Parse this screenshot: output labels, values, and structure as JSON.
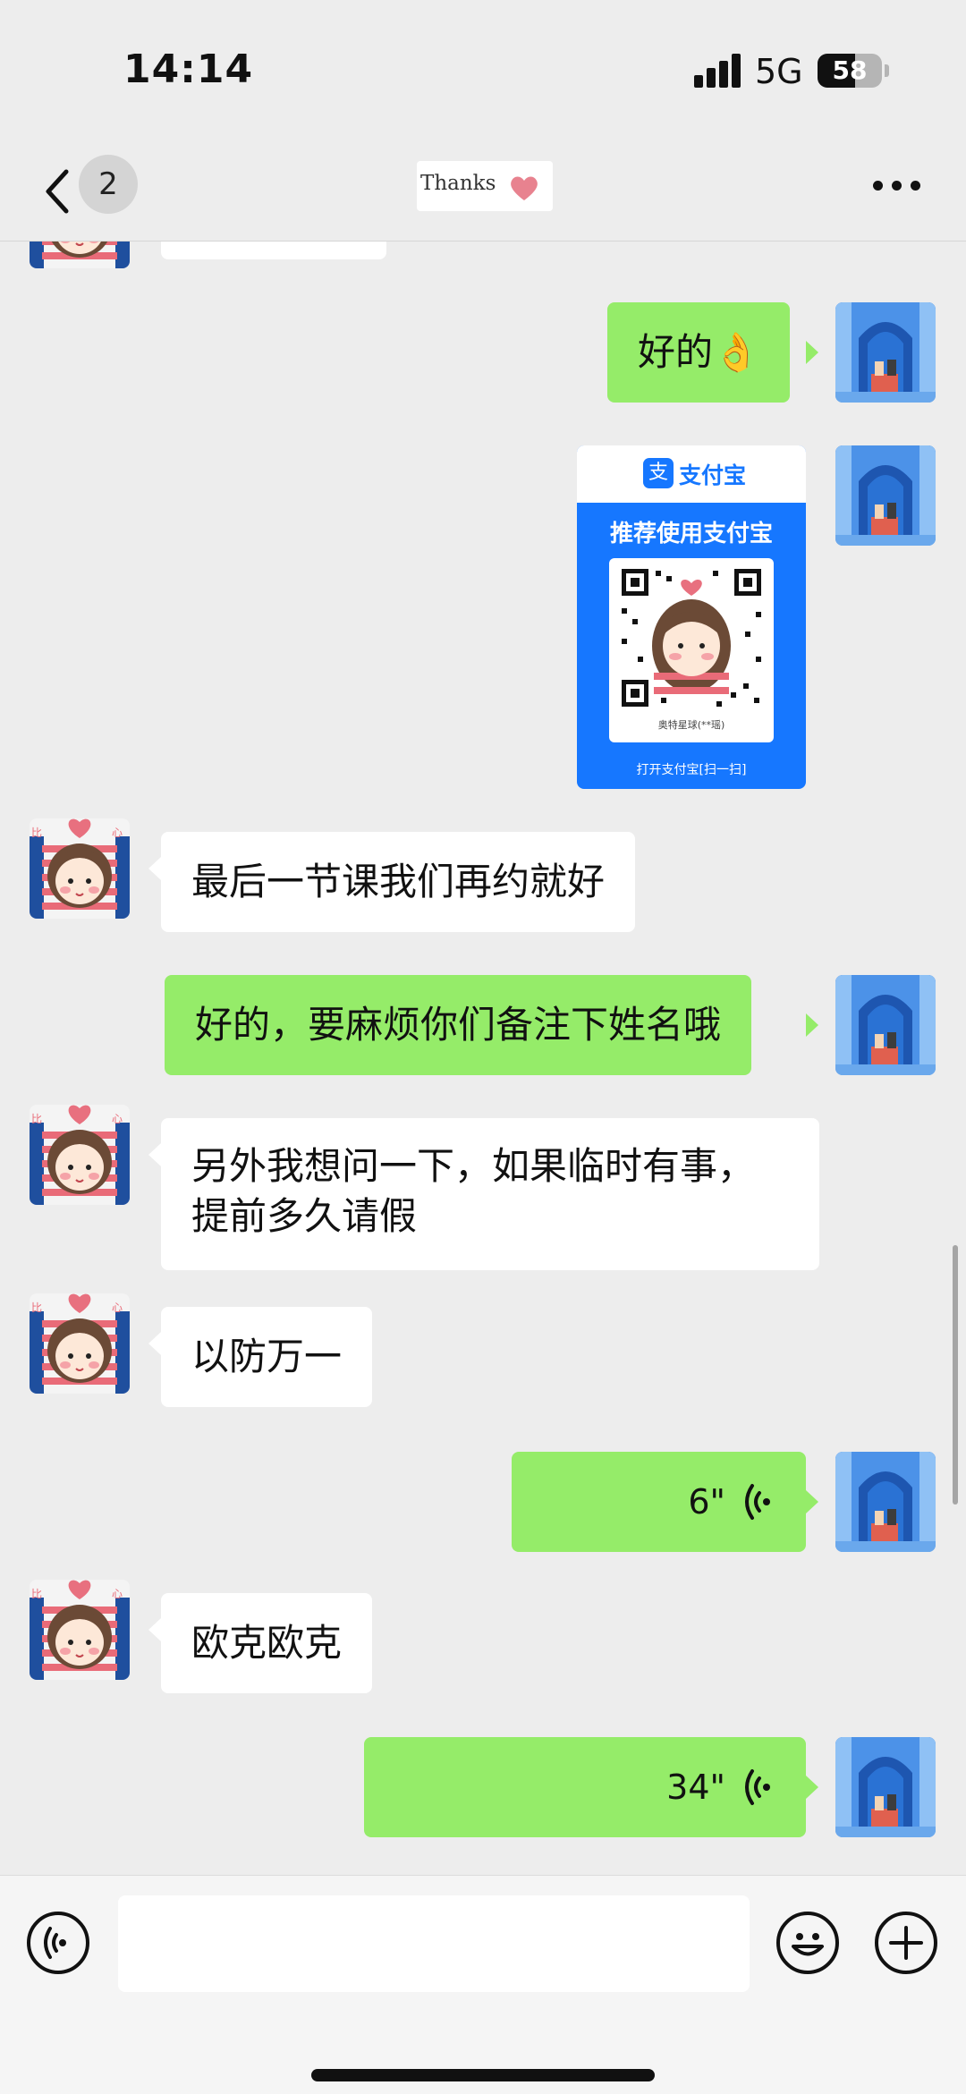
{
  "status_bar": {
    "time": "14:14",
    "network": "5G",
    "battery": "58",
    "battery_level": 0.58
  },
  "header": {
    "unread_count": "2",
    "title": "Thanks",
    "title_icon": "heart-icon",
    "back_icon": "chevron-left-icon",
    "more_icon": "more-dots-icon"
  },
  "colors": {
    "background": "#ededed",
    "outgoing_bubble": "#95ec69",
    "incoming_bubble": "#ffffff",
    "alipay_blue": "#1677ff",
    "heart": "#e8828f"
  },
  "messages": [
    {
      "from": "me",
      "type": "text",
      "text": "好的👌"
    },
    {
      "from": "me",
      "type": "alipay_qr",
      "brand": "支付宝",
      "recommend": "推荐使用支付宝",
      "merchant": "奥特星球(**瑶)",
      "scan_hint": "打开支付宝[扫一扫]"
    },
    {
      "from": "other",
      "type": "text",
      "text": "最后一节课我们再约就好"
    },
    {
      "from": "me",
      "type": "text",
      "text": "好的，要麻烦你们备注下姓名哦"
    },
    {
      "from": "other",
      "type": "text",
      "text": "另外我想问一下，如果临时有事，",
      "text2": "提前多久请假"
    },
    {
      "from": "other",
      "type": "text",
      "text": "以防万一"
    },
    {
      "from": "me",
      "type": "voice",
      "duration": "6\""
    },
    {
      "from": "other",
      "type": "text",
      "text": "欧克欧克"
    },
    {
      "from": "me",
      "type": "voice",
      "duration": "34\""
    }
  ],
  "input_bar": {
    "voice_icon": "voice-input-icon",
    "emoji_icon": "emoji-icon",
    "plus_icon": "plus-icon",
    "placeholder": ""
  }
}
